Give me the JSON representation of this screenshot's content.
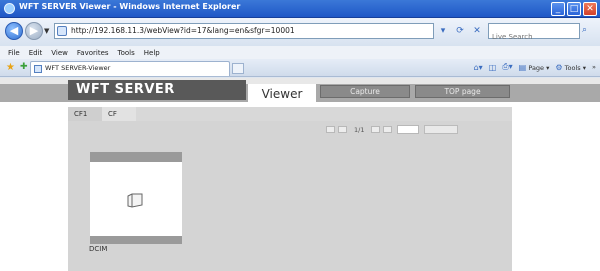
{
  "window": {
    "title": "WFT SERVER Viewer - Windows Internet Explorer",
    "minimize": "_",
    "maximize": "□",
    "close": "✕"
  },
  "addressbar": {
    "url": "http://192.168.11.3/webView?id=17&lang=en&sfgr=10001",
    "search_placeholder": "Live Search"
  },
  "menu": {
    "items": [
      "File",
      "Edit",
      "View",
      "Favorites",
      "Tools",
      "Help"
    ]
  },
  "tabs": {
    "active_label": "WFT SERVER-Viewer"
  },
  "commandbar": {
    "page": "Page",
    "tools": "Tools"
  },
  "header": {
    "logo": "WFT SERVER",
    "section": "Viewer",
    "capture_button": "Capture",
    "top_button": "TOP page"
  },
  "viewer": {
    "slot_tabs": [
      "CF1",
      "CF"
    ],
    "page_count": "1/1",
    "folder_label": "DCIM"
  }
}
